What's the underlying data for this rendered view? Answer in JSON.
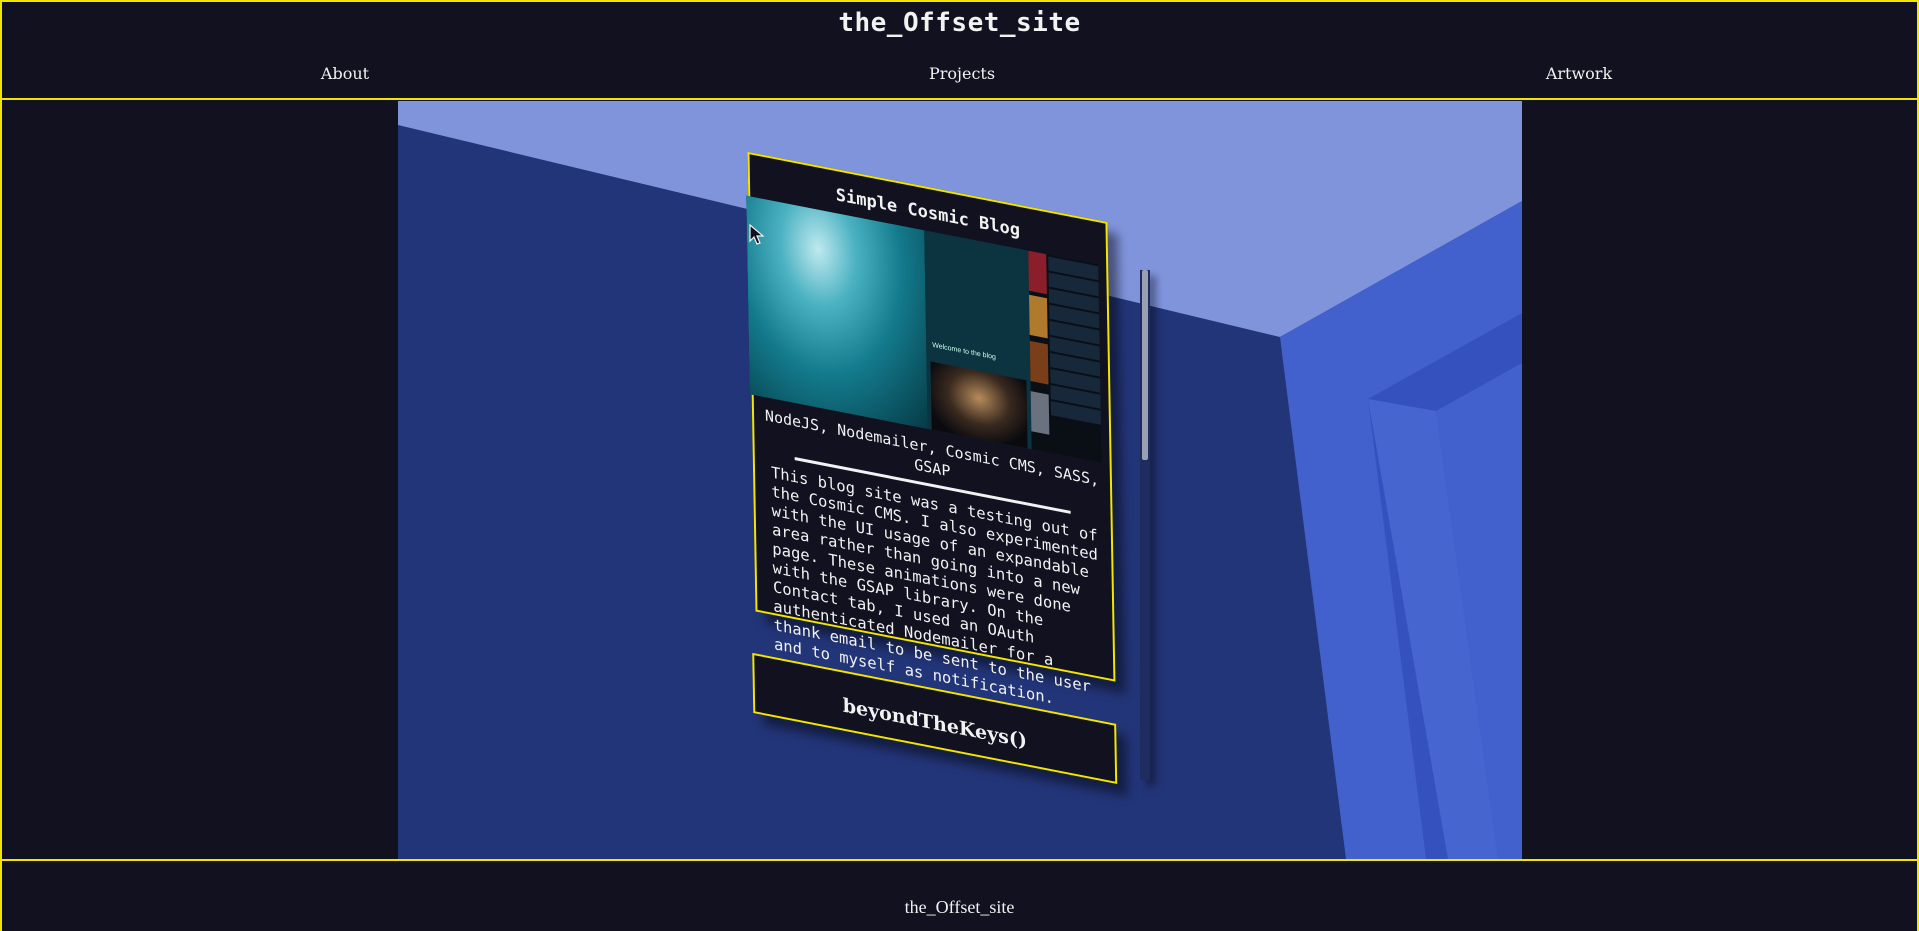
{
  "header": {
    "site_title": "the_Offset_site",
    "nav": [
      {
        "label": "About"
      },
      {
        "label": "Projects"
      },
      {
        "label": "Artwork"
      }
    ]
  },
  "colors": {
    "background": "#11111f",
    "accent_border": "#f2e600",
    "wall_dark": "#233579",
    "ceiling": "#8094dc",
    "wall_light": "#4361cc"
  },
  "projects": [
    {
      "title": "Simple Cosmic Blog",
      "thumbnail_caption": "Welcome to the blog",
      "tech": "NodeJS, Nodemailer, Cosmic CMS, SASS, GSAP",
      "description": "This blog site was a testing out of the Cosmic CMS. I also experimented with the UI usage of an expandable area rather than going into a new page. These animations were done with the GSAP library. On the Contact tab, I used an OAuth authenticated Nodemailer for a thank email to be sent to the user and to myself as notification."
    },
    {
      "title": "beyondTheKeys()"
    }
  ],
  "footer": {
    "text": "the_Offset_site"
  }
}
